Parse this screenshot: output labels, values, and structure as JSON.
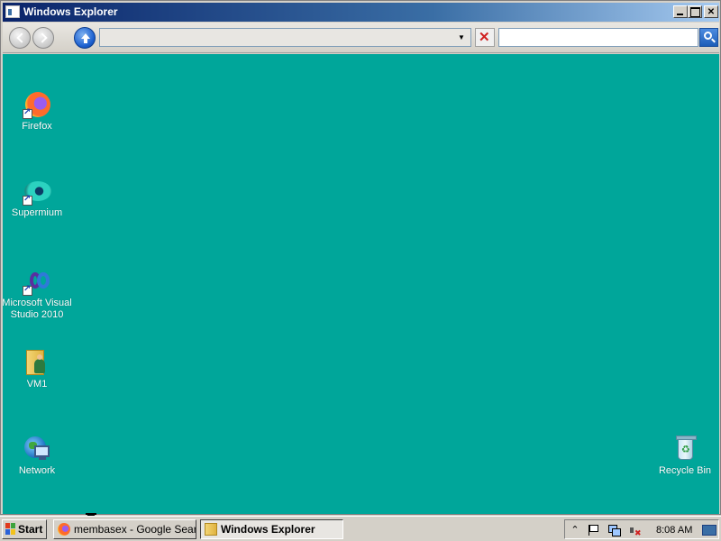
{
  "window": {
    "title": "Windows Explorer",
    "caption_buttons": {
      "minimize": "",
      "maximize": "",
      "close": "✕"
    }
  },
  "toolbar": {
    "address_value": "",
    "address_dropdown": "▼",
    "search_value": ""
  },
  "desktop": {
    "background": "#00a69a",
    "icons": [
      {
        "label": "Firefox",
        "icon": "firefox-icon"
      },
      {
        "label": "Supermium",
        "icon": "supermium-icon"
      },
      {
        "label": "Microsoft Visual Studio 2010",
        "icon": "visual-studio-icon"
      },
      {
        "label": "VM1",
        "icon": "user-folder-icon"
      },
      {
        "label": "Network",
        "icon": "network-icon"
      },
      {
        "label": "Recycle Bin",
        "icon": "recycle-bin-icon"
      }
    ]
  },
  "taskbar": {
    "start_label": "Start",
    "tasks": [
      {
        "label": "membasex - Google Sear...",
        "active": false
      },
      {
        "label": "Windows Explorer",
        "active": true
      }
    ],
    "tray": {
      "chevron": "⌃",
      "clock": "8:08 AM"
    }
  }
}
